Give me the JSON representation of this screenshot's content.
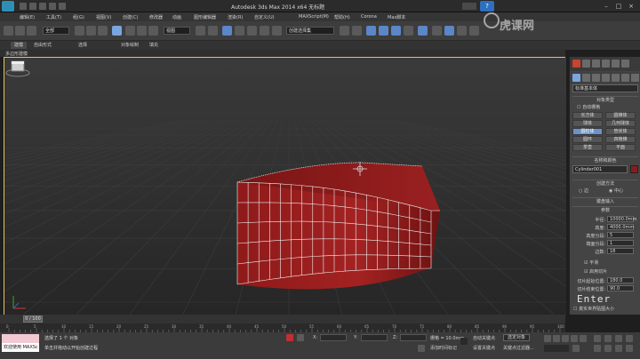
{
  "title": {
    "text": "Autodesk 3ds Max  2014 x64      无标题"
  },
  "menu": [
    "编辑(E)",
    "工具(T)",
    "组(G)",
    "视图(V)",
    "创建(C)",
    "修改器",
    "动画",
    "图形编辑器",
    "渲染(R)",
    "自定义(U)",
    "MAXScript(M)",
    "帮助(H)",
    "Corona",
    "Max脚本"
  ],
  "toolbar": {
    "filter": "全部",
    "view": "视图",
    "selection_set": "创建选择集"
  },
  "ribbon": {
    "tabs": [
      "建模",
      "自由形式",
      "选择",
      "对象绘制",
      "填充"
    ]
  },
  "subbar": {
    "label": "多边形建模"
  },
  "viewport": {
    "label": "[+] [透视] [真实]"
  },
  "command_panel": {
    "category": "标准基本体",
    "section_object_type": "对象类型",
    "auto_grid": "自动栅格",
    "buttons": [
      "长方体",
      "圆锥体",
      "球体",
      "几何球体",
      "圆柱体",
      "管状体",
      "圆环",
      "四棱锥",
      "茶壶",
      "平面"
    ],
    "active_button": "圆柱体",
    "section_name_color": "名称和颜色",
    "object_name": "Cylinder001",
    "object_color": "#8a1c1c",
    "section_creation_method": "创建方法",
    "radio_edge": "边",
    "radio_center": "中心",
    "section_keyboard": "键盘输入",
    "section_params": "参数",
    "params": [
      {
        "label": "半径:",
        "value": "10000.0mm"
      },
      {
        "label": "高度:",
        "value": "4000.0mm"
      },
      {
        "label": "高度分段:",
        "value": "5"
      },
      {
        "label": "端面分段:",
        "value": "1"
      },
      {
        "label": "边数:",
        "value": "18"
      }
    ],
    "smooth": "平滑",
    "slice_on": "启用切片",
    "slice_from_label": "切片起始位置:",
    "slice_from": "180.0",
    "slice_to_label": "切片结束位置:",
    "slice_to": "90.0",
    "enter_overlay": "Enter",
    "real_world_map": "真实世界贴图大小"
  },
  "timeline": {
    "frame": "0 / 100",
    "ticks": [
      "0",
      "5",
      "10",
      "15",
      "20",
      "25",
      "30",
      "35",
      "40",
      "45",
      "50",
      "55",
      "60",
      "65",
      "70",
      "75",
      "80",
      "85",
      "90",
      "95",
      "100"
    ]
  },
  "status": {
    "maxscript_text": "欢迎使用 MAXSc",
    "selected": "选择了 1 个 对象",
    "hint": "单击并拖动以开始创建过程",
    "x_label": "X:",
    "y_label": "Y:",
    "z_label": "Z:",
    "grid": "栅格 = 10.0mm",
    "add_time_tag": "添加时间标记",
    "auto_key": "自动关键点",
    "set_key": "设置关键点",
    "selected_obj": "选定对象",
    "key_filters": "关键点过滤器..."
  },
  "watermark": "虎课网"
}
